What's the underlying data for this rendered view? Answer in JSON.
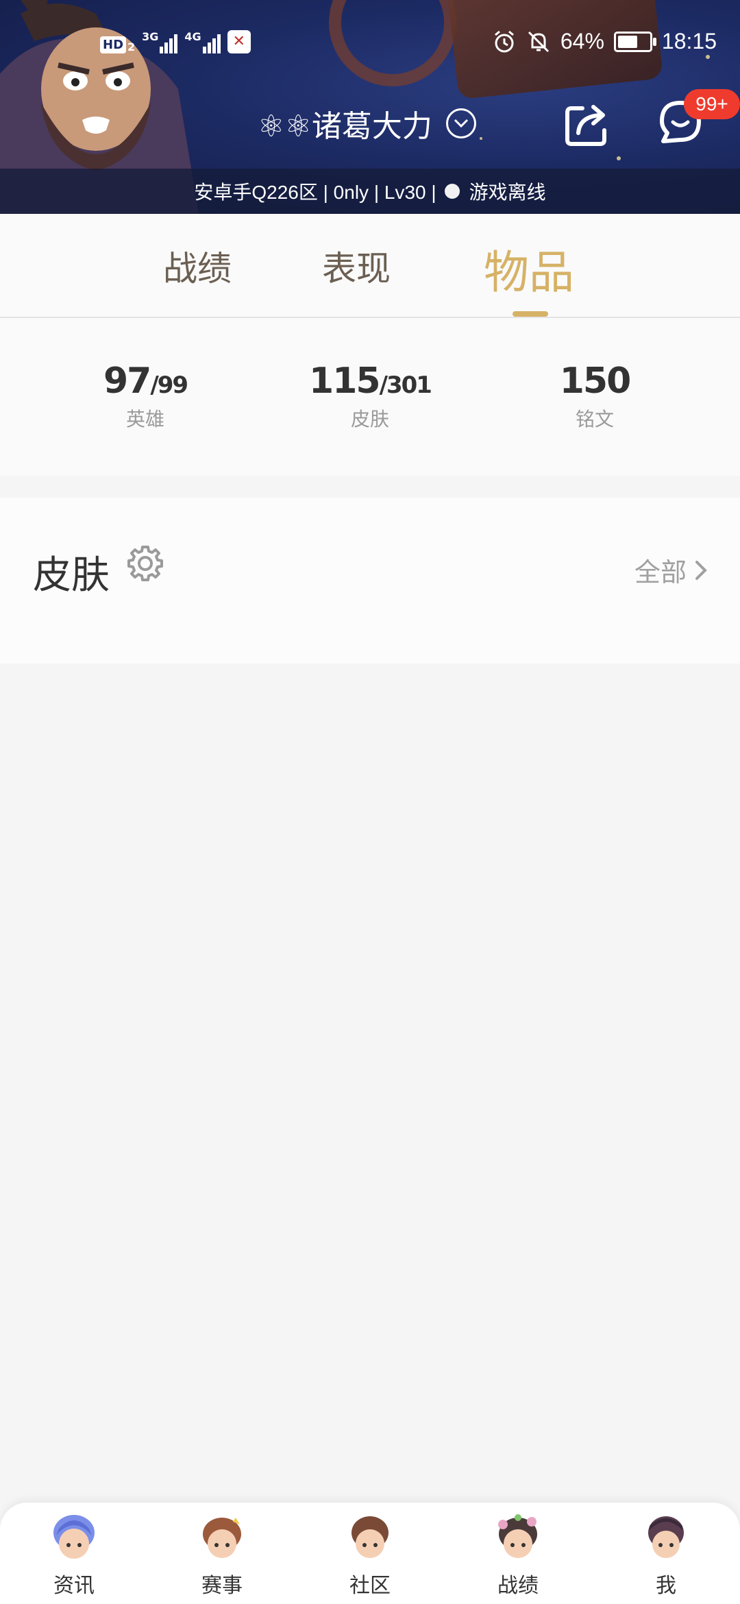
{
  "status_bar": {
    "hd_label": "HD",
    "hd_sub": "2",
    "net1": "3G",
    "net2": "4G",
    "battery_percent": "64%",
    "battery_level": 0.64,
    "time": "18:15"
  },
  "header": {
    "profile_name": "⚛⚛诸葛大力",
    "message_badge": "99+",
    "server_info": "安卓手Q226区 | 0nly | Lv30 |",
    "online_status": "游戏离线"
  },
  "tabs": [
    {
      "label": "战绩",
      "active": false
    },
    {
      "label": "表现",
      "active": false
    },
    {
      "label": "物品",
      "active": true
    }
  ],
  "stats": [
    {
      "count": "97",
      "total": "/99",
      "label": "英雄"
    },
    {
      "count": "115",
      "total": "/301",
      "label": "皮肤"
    },
    {
      "count": "150",
      "total": "",
      "label": "铭文"
    }
  ],
  "skin_section": {
    "title": "皮肤",
    "view_all": "全部"
  },
  "bottom_nav": [
    {
      "label": "资讯",
      "icon": "news-avatar-icon"
    },
    {
      "label": "赛事",
      "icon": "events-avatar-icon"
    },
    {
      "label": "社区",
      "icon": "community-avatar-icon"
    },
    {
      "label": "战绩",
      "icon": "record-avatar-icon"
    },
    {
      "label": "我",
      "icon": "me-avatar-icon"
    }
  ],
  "colors": {
    "accent_gold": "#d6b266",
    "badge_red": "#ef3b2d",
    "header_blue": "#1c2a63"
  }
}
